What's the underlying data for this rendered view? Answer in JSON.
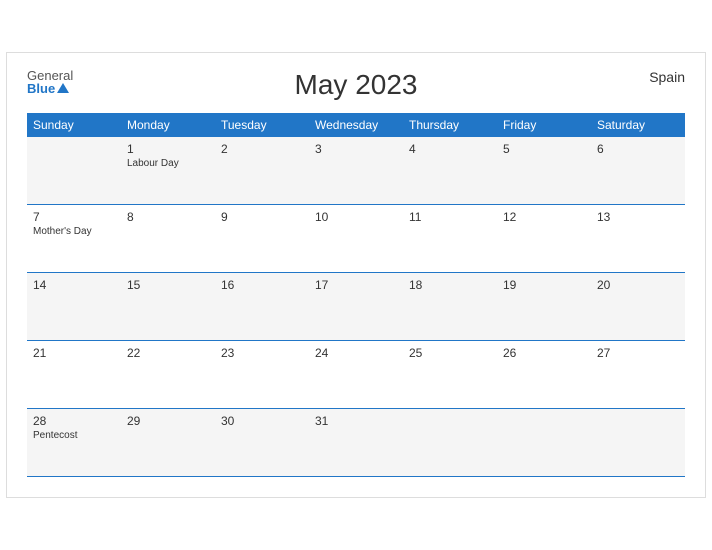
{
  "header": {
    "title": "May 2023",
    "country": "Spain",
    "logo_general": "General",
    "logo_blue": "Blue"
  },
  "weekdays": [
    "Sunday",
    "Monday",
    "Tuesday",
    "Wednesday",
    "Thursday",
    "Friday",
    "Saturday"
  ],
  "weeks": [
    [
      {
        "day": "",
        "event": ""
      },
      {
        "day": "1",
        "event": "Labour Day"
      },
      {
        "day": "2",
        "event": ""
      },
      {
        "day": "3",
        "event": ""
      },
      {
        "day": "4",
        "event": ""
      },
      {
        "day": "5",
        "event": ""
      },
      {
        "day": "6",
        "event": ""
      }
    ],
    [
      {
        "day": "7",
        "event": "Mother's Day"
      },
      {
        "day": "8",
        "event": ""
      },
      {
        "day": "9",
        "event": ""
      },
      {
        "day": "10",
        "event": ""
      },
      {
        "day": "11",
        "event": ""
      },
      {
        "day": "12",
        "event": ""
      },
      {
        "day": "13",
        "event": ""
      }
    ],
    [
      {
        "day": "14",
        "event": ""
      },
      {
        "day": "15",
        "event": ""
      },
      {
        "day": "16",
        "event": ""
      },
      {
        "day": "17",
        "event": ""
      },
      {
        "day": "18",
        "event": ""
      },
      {
        "day": "19",
        "event": ""
      },
      {
        "day": "20",
        "event": ""
      }
    ],
    [
      {
        "day": "21",
        "event": ""
      },
      {
        "day": "22",
        "event": ""
      },
      {
        "day": "23",
        "event": ""
      },
      {
        "day": "24",
        "event": ""
      },
      {
        "day": "25",
        "event": ""
      },
      {
        "day": "26",
        "event": ""
      },
      {
        "day": "27",
        "event": ""
      }
    ],
    [
      {
        "day": "28",
        "event": "Pentecost"
      },
      {
        "day": "29",
        "event": ""
      },
      {
        "day": "30",
        "event": ""
      },
      {
        "day": "31",
        "event": ""
      },
      {
        "day": "",
        "event": ""
      },
      {
        "day": "",
        "event": ""
      },
      {
        "day": "",
        "event": ""
      }
    ]
  ]
}
